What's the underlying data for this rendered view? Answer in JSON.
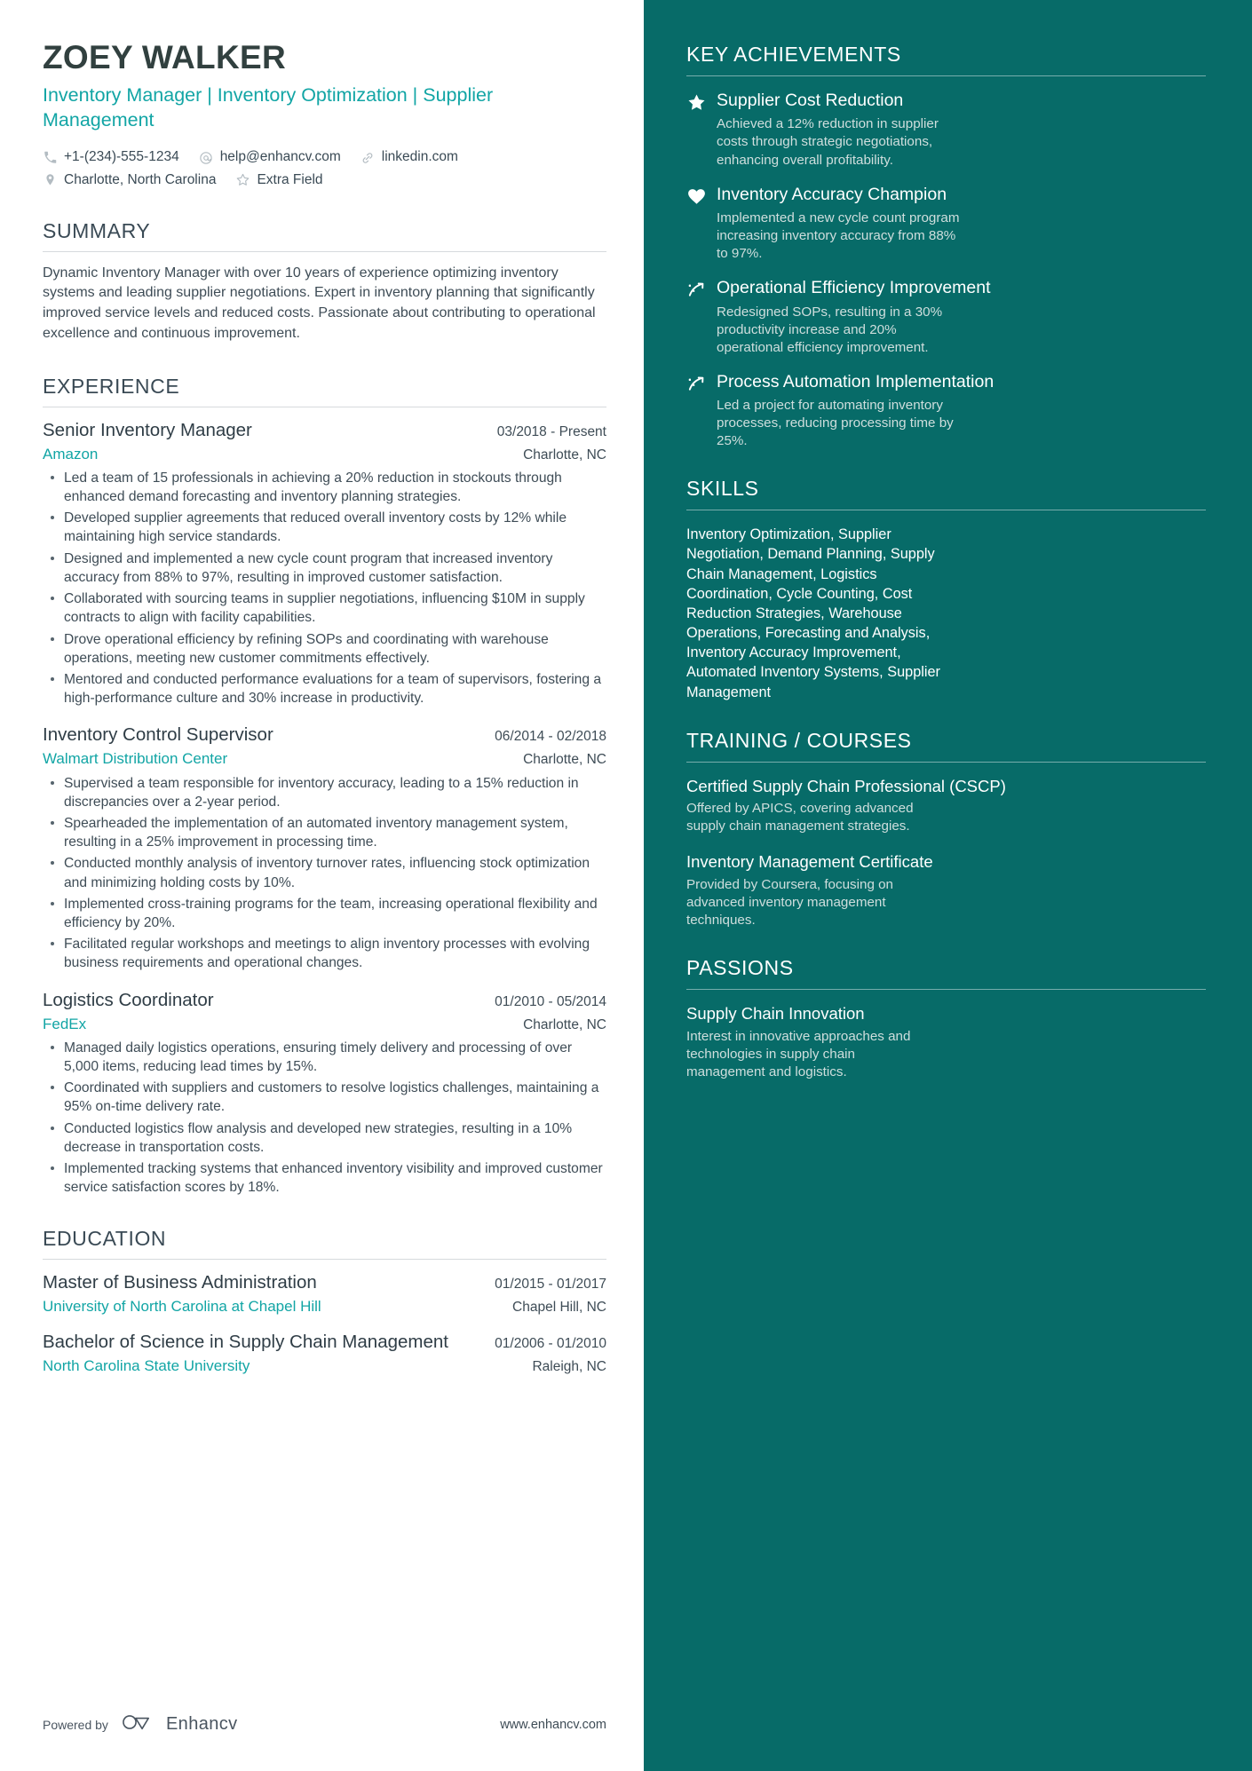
{
  "header": {
    "name": "ZOEY WALKER",
    "headline": "Inventory Manager | Inventory Optimization | Supplier Management",
    "contacts_line1": [
      {
        "icon": "phone-icon",
        "text": "+1-(234)-555-1234"
      },
      {
        "icon": "email-icon",
        "text": "help@enhancv.com"
      },
      {
        "icon": "link-icon",
        "text": "linkedin.com"
      }
    ],
    "contacts_line2": [
      {
        "icon": "location-pin-icon",
        "text": "Charlotte, North Carolina"
      },
      {
        "icon": "star-outline-icon",
        "text": "Extra Field"
      }
    ]
  },
  "summary": {
    "title": "SUMMARY",
    "text": "Dynamic Inventory Manager with over 10 years of experience optimizing inventory systems and leading supplier negotiations. Expert in inventory planning that significantly improved service levels and reduced costs. Passionate about contributing to operational excellence and continuous improvement."
  },
  "experience": {
    "title": "EXPERIENCE",
    "entries": [
      {
        "role": "Senior Inventory Manager",
        "date": "03/2018 - Present",
        "company": "Amazon",
        "location": "Charlotte, NC",
        "bullets": [
          "Led a team of 15 professionals in achieving a 20% reduction in stockouts through enhanced demand forecasting and inventory planning strategies.",
          "Developed supplier agreements that reduced overall inventory costs by 12% while maintaining high service standards.",
          "Designed and implemented a new cycle count program that increased inventory accuracy from 88% to 97%, resulting in improved customer satisfaction.",
          "Collaborated with sourcing teams in supplier negotiations, influencing $10M in supply contracts to align with facility capabilities.",
          "Drove operational efficiency by refining SOPs and coordinating with warehouse operations, meeting new customer commitments effectively.",
          "Mentored and conducted performance evaluations for a team of supervisors, fostering a high-performance culture and 30% increase in productivity."
        ]
      },
      {
        "role": "Inventory Control Supervisor",
        "date": "06/2014 - 02/2018",
        "company": "Walmart Distribution Center",
        "location": "Charlotte, NC",
        "bullets": [
          "Supervised a team responsible for inventory accuracy, leading to a 15% reduction in discrepancies over a 2-year period.",
          "Spearheaded the implementation of an automated inventory management system, resulting in a 25% improvement in processing time.",
          "Conducted monthly analysis of inventory turnover rates, influencing stock optimization and minimizing holding costs by 10%.",
          "Implemented cross-training programs for the team, increasing operational flexibility and efficiency by 20%.",
          "Facilitated regular workshops and meetings to align inventory processes with evolving business requirements and operational changes."
        ]
      },
      {
        "role": "Logistics Coordinator",
        "date": "01/2010 - 05/2014",
        "company": "FedEx",
        "location": "Charlotte, NC",
        "bullets": [
          "Managed daily logistics operations, ensuring timely delivery and processing of over 5,000 items, reducing lead times by 15%.",
          "Coordinated with suppliers and customers to resolve logistics challenges, maintaining a 95% on-time delivery rate.",
          "Conducted logistics flow analysis and developed new strategies, resulting in a 10% decrease in transportation costs.",
          "Implemented tracking systems that enhanced inventory visibility and improved customer service satisfaction scores by 18%."
        ]
      }
    ]
  },
  "education": {
    "title": "EDUCATION",
    "entries": [
      {
        "degree": "Master of Business Administration",
        "date": "01/2015 - 01/2017",
        "school": "University of North Carolina at Chapel Hill",
        "location": "Chapel Hill, NC"
      },
      {
        "degree": "Bachelor of Science in Supply Chain Management",
        "date": "01/2006 - 01/2010",
        "school": "North Carolina State University",
        "location": "Raleigh, NC"
      }
    ]
  },
  "footer": {
    "powered_by": "Powered by",
    "brand": "Enhancv",
    "url": "www.enhancv.com"
  },
  "sidebar": {
    "key_achievements": {
      "title": "KEY ACHIEVEMENTS",
      "items": [
        {
          "icon": "star-filled-icon",
          "title": "Supplier Cost Reduction",
          "desc": "Achieved a 12% reduction in supplier costs through strategic negotiations, enhancing overall profitability."
        },
        {
          "icon": "heart-filled-icon",
          "title": "Inventory Accuracy Champion",
          "desc": "Implemented a new cycle count program increasing inventory accuracy from 88% to 97%."
        },
        {
          "icon": "trending-arrow-icon",
          "title": "Operational Efficiency Improvement",
          "desc": "Redesigned SOPs, resulting in a 30% productivity increase and 20% operational efficiency improvement."
        },
        {
          "icon": "trending-arrow-icon",
          "title": "Process Automation Implementation",
          "desc": "Led a project for automating inventory processes, reducing processing time by 25%."
        }
      ]
    },
    "skills": {
      "title": "SKILLS",
      "text": "Inventory Optimization, Supplier Negotiation, Demand Planning, Supply Chain Management, Logistics Coordination, Cycle Counting, Cost Reduction Strategies, Warehouse Operations, Forecasting and Analysis, Inventory Accuracy Improvement, Automated Inventory Systems, Supplier Management"
    },
    "training": {
      "title": "TRAINING / COURSES",
      "items": [
        {
          "title": "Certified Supply Chain Professional (CSCP)",
          "desc": "Offered by APICS, covering advanced supply chain management strategies."
        },
        {
          "title": "Inventory Management Certificate",
          "desc": "Provided by Coursera, focusing on advanced inventory management techniques."
        }
      ]
    },
    "passions": {
      "title": "PASSIONS",
      "items": [
        {
          "title": "Supply Chain Innovation",
          "desc": "Interest in innovative approaches and technologies in supply chain management and logistics."
        }
      ]
    }
  },
  "colors": {
    "accent_teal": "#12a5a5",
    "sidebar_bg": "#076b68",
    "heading_dark": "#3a4a55"
  }
}
